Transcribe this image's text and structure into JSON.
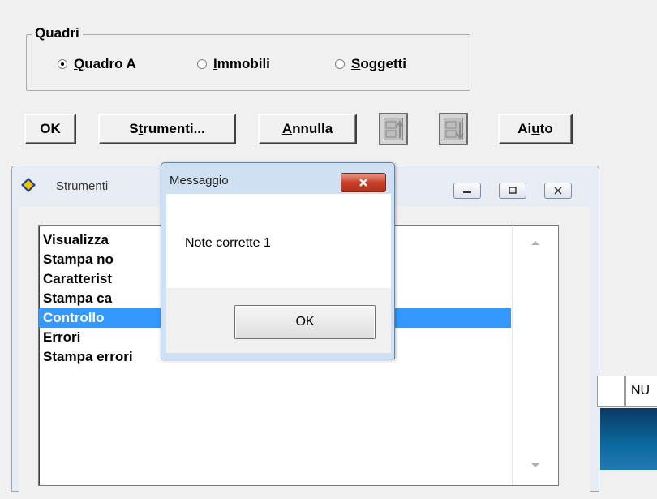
{
  "group": {
    "title": "Quadri",
    "options": [
      {
        "pre": "",
        "acc": "Q",
        "post": "uadro A",
        "checked": true
      },
      {
        "pre": "",
        "acc": "I",
        "post": "mmobili",
        "checked": false
      },
      {
        "pre": "",
        "acc": "S",
        "post": "oggetti",
        "checked": false
      }
    ]
  },
  "toolbar": {
    "ok": "OK",
    "strumenti_pre": "S",
    "strumenti_acc": "t",
    "strumenti_post": "rumenti...",
    "annulla_acc": "A",
    "annulla_post": "nnulla",
    "su_icon": "su-arrow-up-icon",
    "giu_icon": "giu-arrow-down-icon",
    "aiuto_pre": "Ai",
    "aiuto_acc": "u",
    "aiuto_post": "to"
  },
  "window": {
    "title": "Strumenti",
    "list_items": [
      "Visualizza",
      "Stampa no",
      "Caratterist",
      "Stampa ca",
      "Controllo",
      "Errori",
      "Stampa errori"
    ],
    "selected_index": 4
  },
  "right_field": "NU",
  "dialog": {
    "title": "Messaggio",
    "message": "Note corrette  1",
    "ok": "OK"
  }
}
